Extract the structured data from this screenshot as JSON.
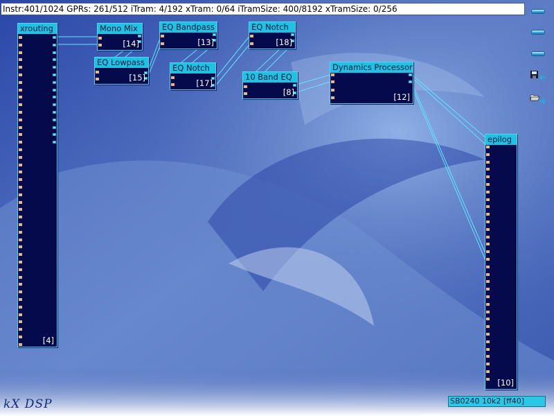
{
  "status_bar": {
    "text": "Instr:401/1024 GPRs: 261/512 iTram: 4/192 xTram: 0/64 iTramSize: 400/8192 xTramSize: 0/256"
  },
  "toolbar": {
    "buttons": [
      {
        "icon": "menu-bar-icon"
      },
      {
        "icon": "menu-bar-icon"
      },
      {
        "icon": "menu-bar-icon"
      },
      {
        "icon": "save-icon"
      },
      {
        "icon": "open-folder-icon"
      }
    ]
  },
  "plugins": {
    "xrouting": {
      "title": "xrouting",
      "id": "[4]"
    },
    "mono_mix": {
      "title": "Mono Mix",
      "id": "[14]"
    },
    "eq_lowpass": {
      "title": "EQ Lowpass",
      "id": "[15]"
    },
    "eq_bandpass": {
      "title": "EQ Bandpass",
      "id": "[13]"
    },
    "eq_notch_17": {
      "title": "EQ Notch",
      "id": "[17]"
    },
    "eq_notch_18": {
      "title": "EQ Notch",
      "id": "[18]"
    },
    "band_eq": {
      "title": "10 Band EQ",
      "id": "[8]"
    },
    "dynamics": {
      "title": "Dynamics Processor",
      "id": "[12]"
    },
    "epilog": {
      "title": "epilog",
      "id": "[10]"
    }
  },
  "footer": {
    "logo": "kX DSP",
    "device": "SB0240 10k2 [ff40]"
  },
  "colors": {
    "background": "#4866b3",
    "plugin_body": "#050a4c",
    "plugin_title": "#1fc2e2",
    "wire": "#5fe4ff"
  }
}
